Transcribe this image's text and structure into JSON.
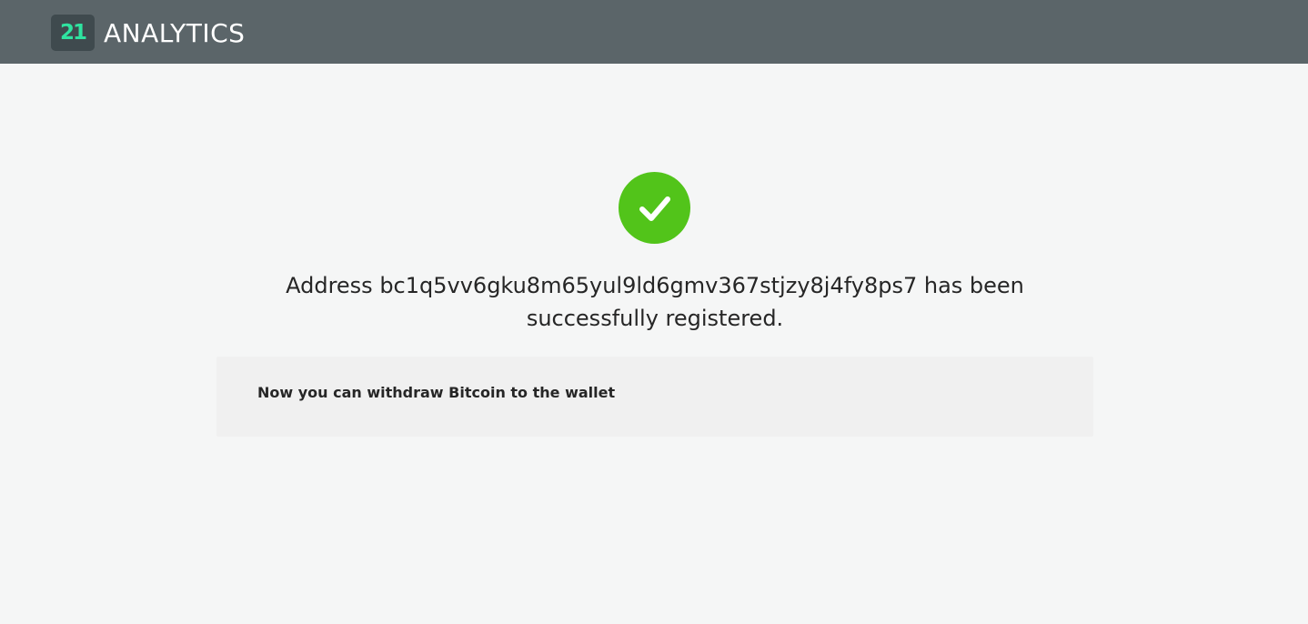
{
  "header": {
    "logo_mark": "21",
    "logo_text": "ANALYTICS"
  },
  "result": {
    "status_icon": "check-circle-icon",
    "status_color": "#52c41a",
    "message": "Address bc1q5vv6gku8m65yul9ld6gmv367stjzy8j4fy8ps7 has been successfully registered.",
    "info": "Now you can withdraw Bitcoin to the wallet"
  },
  "colors": {
    "header_bg": "#5b6569",
    "page_bg": "#f5f6f6",
    "logo_accent": "#2fe3a0"
  }
}
